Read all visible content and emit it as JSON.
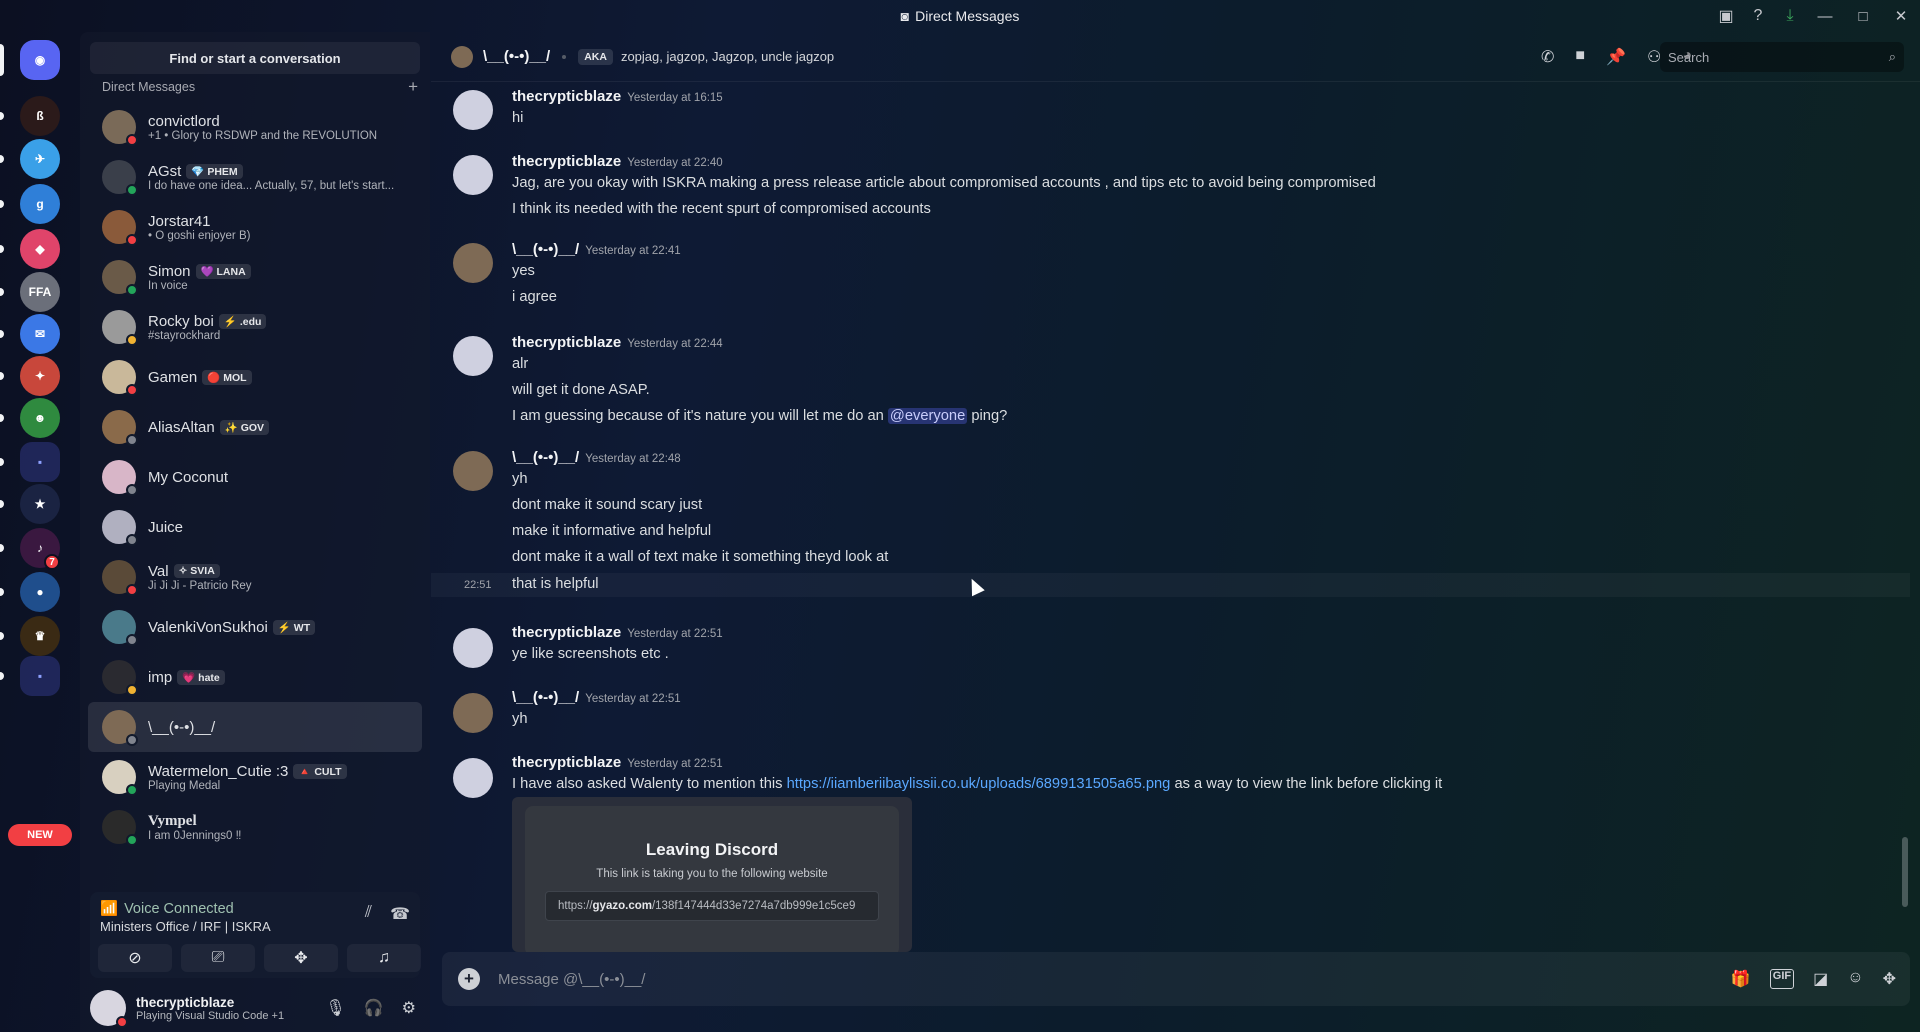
{
  "window": {
    "title": "Direct Messages",
    "icons": [
      "inbox-icon",
      "help-icon",
      "download-icon"
    ],
    "controls": [
      "—",
      "□",
      "✕"
    ]
  },
  "servers": [
    {
      "name": "discord-home",
      "color": "#5865f2",
      "glyph": "◉"
    },
    {
      "name": "server-1",
      "color": "#2b1a1a",
      "glyph": "ß"
    },
    {
      "name": "server-2",
      "color": "#3aa0e8",
      "glyph": "✈"
    },
    {
      "name": "server-3",
      "color": "#2f7fd8",
      "glyph": "g"
    },
    {
      "name": "server-4",
      "color": "#e0446a",
      "glyph": "◆"
    },
    {
      "name": "server-5",
      "color": "#6b6f7a",
      "glyph": "FFA"
    },
    {
      "name": "server-6",
      "color": "#3b78e6",
      "glyph": "✉"
    },
    {
      "name": "server-7",
      "color": "#c8473b",
      "glyph": "✦"
    },
    {
      "name": "server-8",
      "color": "#2f8a3f",
      "glyph": "☻"
    },
    {
      "name": "folder-1",
      "color": "#23305c",
      "glyph": "▪"
    },
    {
      "name": "server-9",
      "color": "#1a2342",
      "glyph": "★"
    },
    {
      "name": "server-10",
      "color": "#3a1840",
      "glyph": "♪",
      "badge": "7"
    },
    {
      "name": "server-11",
      "color": "#1f4e8c",
      "glyph": "●"
    },
    {
      "name": "server-12",
      "color": "#3a2a14",
      "glyph": "♛"
    },
    {
      "name": "folder-2",
      "color": "#23305c",
      "glyph": "▪"
    }
  ],
  "new_badge": "NEW",
  "sidebar": {
    "search_label": "Find or start a conversation",
    "section_title": "Direct Messages",
    "add_glyph": "+",
    "dms": [
      {
        "name": "convictlord",
        "tag": "",
        "sub": "+1 • Glory to RSDWP and the REVOLUTION",
        "status": "dnd",
        "color": "#7a6a58"
      },
      {
        "name": "AGst",
        "tag": "💎 PHEM",
        "sub": "I do have one idea... Actually, 57, but let's start...",
        "status": "online",
        "color": "#3a3f4a"
      },
      {
        "name": "Jorstar41",
        "tag": "",
        "sub": "• O goshi enjoyer B)",
        "status": "dnd",
        "color": "#8a5a3a"
      },
      {
        "name": "Simon",
        "tag": "💜 LANA",
        "sub": "In voice",
        "status": "online",
        "color": "#6a5a48"
      },
      {
        "name": "Rocky boi",
        "tag": "⚡ .edu",
        "sub": "#stayrockhard",
        "status": "idle",
        "color": "#9a9a9a"
      },
      {
        "name": "Gamen",
        "tag": "🔴 MOL",
        "sub": "",
        "status": "dnd",
        "color": "#c9b89a"
      },
      {
        "name": "AliasAltan",
        "tag": "✨ GOV",
        "sub": "",
        "status": "off",
        "color": "#8a6a4a"
      },
      {
        "name": "My Coconut",
        "tag": "",
        "sub": "",
        "status": "off",
        "color": "#d8b6c8"
      },
      {
        "name": "Juice",
        "tag": "",
        "sub": "",
        "status": "off",
        "color": "#b0b0c0"
      },
      {
        "name": "Val",
        "tag": "✧ SVIA",
        "sub": "Ji Ji Ji - Patricio Rey",
        "status": "dnd",
        "color": "#5a4a38"
      },
      {
        "name": "ValenkiVonSukhoi",
        "tag": "⚡ WT",
        "sub": "",
        "status": "off",
        "color": "#4a7a8a"
      },
      {
        "name": "imp",
        "tag": "💗 hate",
        "sub": "",
        "status": "idle",
        "color": "#2a2a30"
      },
      {
        "name": "\\__(•-•)__/",
        "tag": "",
        "sub": "",
        "status": "off",
        "color": "#7e6a55",
        "active": true
      },
      {
        "name": "Watermelon_Cutie :3",
        "tag": "🔺 CULT",
        "sub": "Playing Medal",
        "status": "online",
        "color": "#d8d0c0"
      },
      {
        "name": "Vympel",
        "tag": "",
        "sub": "I am 0Jennings0 ‼",
        "status": "online",
        "color": "#2a2a2a"
      }
    ]
  },
  "voice": {
    "title": "Voice Connected",
    "channel": "Ministers Office / IRF | ISKRA",
    "buttons": [
      "camera-off-icon",
      "screen-share-icon",
      "activities-icon",
      "soundboard-icon"
    ]
  },
  "user": {
    "name": "thecrypticblaze",
    "sub": "Playing Visual Studio Code +1",
    "controls": [
      "mic-icon",
      "headphones-icon",
      "settings-icon"
    ]
  },
  "header": {
    "name": "\\__(•-•)__/",
    "aka_label": "AKA",
    "aka_names": "zopjag, jagzop, Jagzop, uncle jagzop",
    "search_placeholder": "Search"
  },
  "messages": [
    {
      "author": "thecrypticblaze",
      "time": "Yesterday at 16:15",
      "lines": [
        "hi"
      ]
    },
    {
      "author": "thecrypticblaze",
      "time": "Yesterday at 22:40",
      "lines": [
        "Jag, are you okay with ISKRA making a press release article about compromised accounts , and tips etc to avoid being compromised",
        "I think its needed with the recent spurt of compromised accounts"
      ]
    },
    {
      "author": "\\__(•-•)__/",
      "time": "Yesterday at 22:41",
      "lines": [
        "yes",
        "i agree"
      ]
    },
    {
      "author": "thecrypticblaze",
      "time": "Yesterday at 22:44",
      "lines": [
        "alr",
        "will get it done ASAP."
      ],
      "mention_line": {
        "before": "I am guessing because of it's nature you will let me do an ",
        "mention": "@everyone",
        "after": " ping?"
      }
    },
    {
      "author": "\\__(•-•)__/",
      "time": "Yesterday at 22:48",
      "lines": [
        "yh",
        "dont make it sound scary just",
        "make it informative and helpful",
        "dont make it a wall of text make it something theyd look at"
      ]
    },
    {
      "continuation_time": "22:51",
      "text": "that is helpful"
    },
    {
      "author": "thecrypticblaze",
      "time": "Yesterday at 22:51",
      "lines": [
        "ye like screenshots etc ."
      ]
    },
    {
      "author": "\\__(•-•)__/",
      "time": "Yesterday at 22:51",
      "lines": [
        "yh"
      ]
    },
    {
      "author": "thecrypticblaze",
      "time": "Yesterday at 22:51",
      "link_line": {
        "before": "I have also asked Walenty to mention this ",
        "link": "https://iiamberiibaylissii.co.uk/uploads/6899131505a65.png",
        "after": " as a way to view the link before clicking it"
      }
    }
  ],
  "embed": {
    "title": "Leaving Discord",
    "subtitle": "This link is taking you to the following website",
    "url_prefix": "https://",
    "url_domain": "gyazo.com",
    "url_path": "/138f147444d33e7274a7db999e1c5ce9"
  },
  "composer": {
    "placeholder": "Message @\\__(•-•)__/",
    "icons": [
      "gift-icon",
      "gif-icon",
      "sticker-icon",
      "emoji-icon",
      "apps-icon"
    ]
  }
}
